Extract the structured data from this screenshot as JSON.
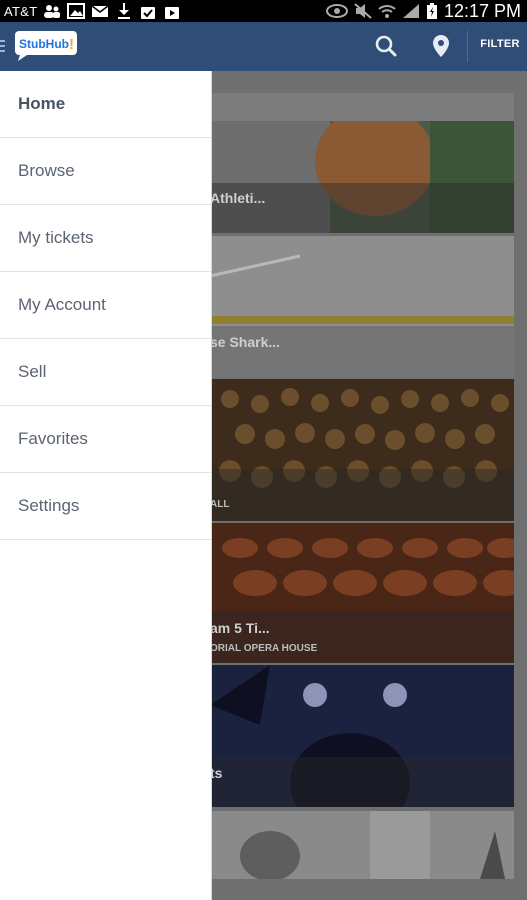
{
  "status_bar": {
    "carrier": "AT&T",
    "time": "12:17 PM"
  },
  "action_bar": {
    "logo_text": "StubHub!",
    "filter_label": "FILTER",
    "colors": {
      "bar": "#2f4d77",
      "logo_blue": "#1c75d8",
      "logo_accent": "#f5a623"
    }
  },
  "drawer": {
    "items": [
      {
        "label": "Home",
        "active": true
      },
      {
        "label": "Browse"
      },
      {
        "label": "My tickets"
      },
      {
        "label": "My Account"
      },
      {
        "label": "Sell"
      },
      {
        "label": "Favorites"
      },
      {
        "label": "Settings"
      }
    ]
  },
  "events": [
    {
      "title": "Athleti...",
      "subtitle": ""
    },
    {
      "title": "se Shark...",
      "subtitle": ""
    },
    {
      "title": "",
      "subtitle": "ALL"
    },
    {
      "title": "am 5 Ti...",
      "subtitle": "ORIAL OPERA HOUSE"
    },
    {
      "title": "ts",
      "subtitle": ""
    },
    {
      "title": "",
      "subtitle": ""
    }
  ]
}
